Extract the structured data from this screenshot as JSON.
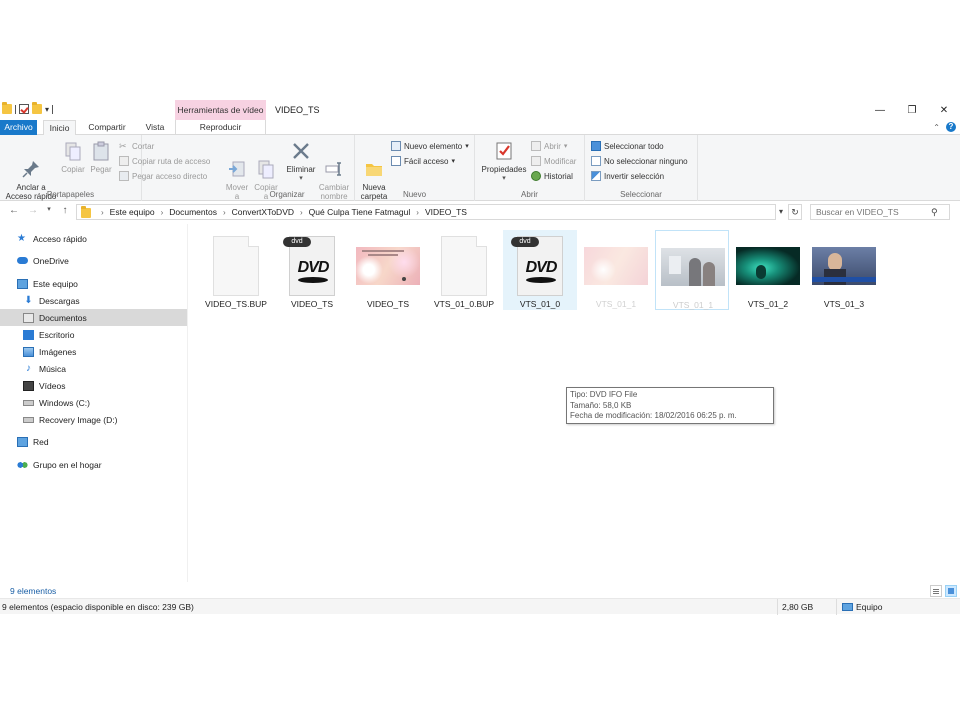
{
  "window": {
    "title": "VIDEO_TS",
    "context_tab_group": "Herramientas de vídeo",
    "controls": {
      "minimize": "—",
      "maximize": "❐",
      "close": "✕"
    }
  },
  "tabs": {
    "archivo": "Archivo",
    "inicio": "Inicio",
    "compartir": "Compartir",
    "vista": "Vista",
    "reproducir": "Reproducir"
  },
  "ribbon": {
    "portapapeles": {
      "label": "Portapapeles",
      "anclar": "Anclar a\nAcceso rápido",
      "copiar": "Copiar",
      "pegar": "Pegar",
      "cortar": "Cortar",
      "copiar_ruta": "Copiar ruta de acceso",
      "pegar_acceso": "Pegar acceso directo"
    },
    "organizar": {
      "label": "Organizar",
      "mover": "Mover\na",
      "copiar_a": "Copiar\na",
      "eliminar": "Eliminar",
      "cambiar_nombre": "Cambiar\nnombre"
    },
    "nuevo": {
      "label": "Nuevo",
      "nueva_carpeta": "Nueva\ncarpeta",
      "nuevo_elemento": "Nuevo elemento",
      "facil_acceso": "Fácil acceso"
    },
    "abrir": {
      "label": "Abrir",
      "propiedades": "Propiedades",
      "abrir": "Abrir",
      "modificar": "Modificar",
      "historial": "Historial"
    },
    "seleccionar": {
      "label": "Seleccionar",
      "todo": "Seleccionar todo",
      "ninguno": "No seleccionar ninguno",
      "invertir": "Invertir selección"
    }
  },
  "address": {
    "crumbs": [
      "Este equipo",
      "Documentos",
      "ConvertXToDVD",
      "Qué Culpa Tiene Fatmagul",
      "VIDEO_TS"
    ],
    "search_placeholder": "Buscar en VIDEO_TS"
  },
  "nav": {
    "items": [
      {
        "label": "Acceso rápido"
      },
      {
        "label": "OneDrive"
      },
      {
        "label": "Este equipo"
      },
      {
        "label": "Descargas"
      },
      {
        "label": "Documentos"
      },
      {
        "label": "Escritorio"
      },
      {
        "label": "Imágenes"
      },
      {
        "label": "Música"
      },
      {
        "label": "Vídeos"
      },
      {
        "label": "Windows (C:)"
      },
      {
        "label": "Recovery Image (D:)"
      },
      {
        "label": "Red"
      },
      {
        "label": "Grupo en el hogar"
      }
    ]
  },
  "files": [
    {
      "name": "VIDEO_TS.BUP",
      "kind": "blank"
    },
    {
      "name": "VIDEO_TS",
      "kind": "dvd"
    },
    {
      "name": "VIDEO_TS",
      "kind": "video-pink"
    },
    {
      "name": "VTS_01_0.BUP",
      "kind": "blank"
    },
    {
      "name": "VTS_01_0",
      "kind": "dvd"
    },
    {
      "name": "VTS_01_1",
      "kind": "video-pink"
    },
    {
      "name": "VTS_01_1",
      "kind": "video-people"
    },
    {
      "name": "VTS_01_2",
      "kind": "video-green"
    },
    {
      "name": "VTS_01_3",
      "kind": "video-news"
    }
  ],
  "dvd_badge": "dvd",
  "dvd_logo": "DVD",
  "tooltip": {
    "line1": "Tipo: DVD IFO File",
    "line2": "Tamaño: 58,0 KB",
    "line3": "Fecha de modificación: 18/02/2016 06:25 p. m."
  },
  "status": {
    "item_count": "9 elementos",
    "disk_info": "9 elementos (espacio disponible en disco: 239 GB)",
    "size": "2,80 GB",
    "zone": "Equipo"
  },
  "colors": {
    "accent": "#1979ca",
    "context_tab": "#f7d2e2",
    "selection": "#cce8ff"
  }
}
